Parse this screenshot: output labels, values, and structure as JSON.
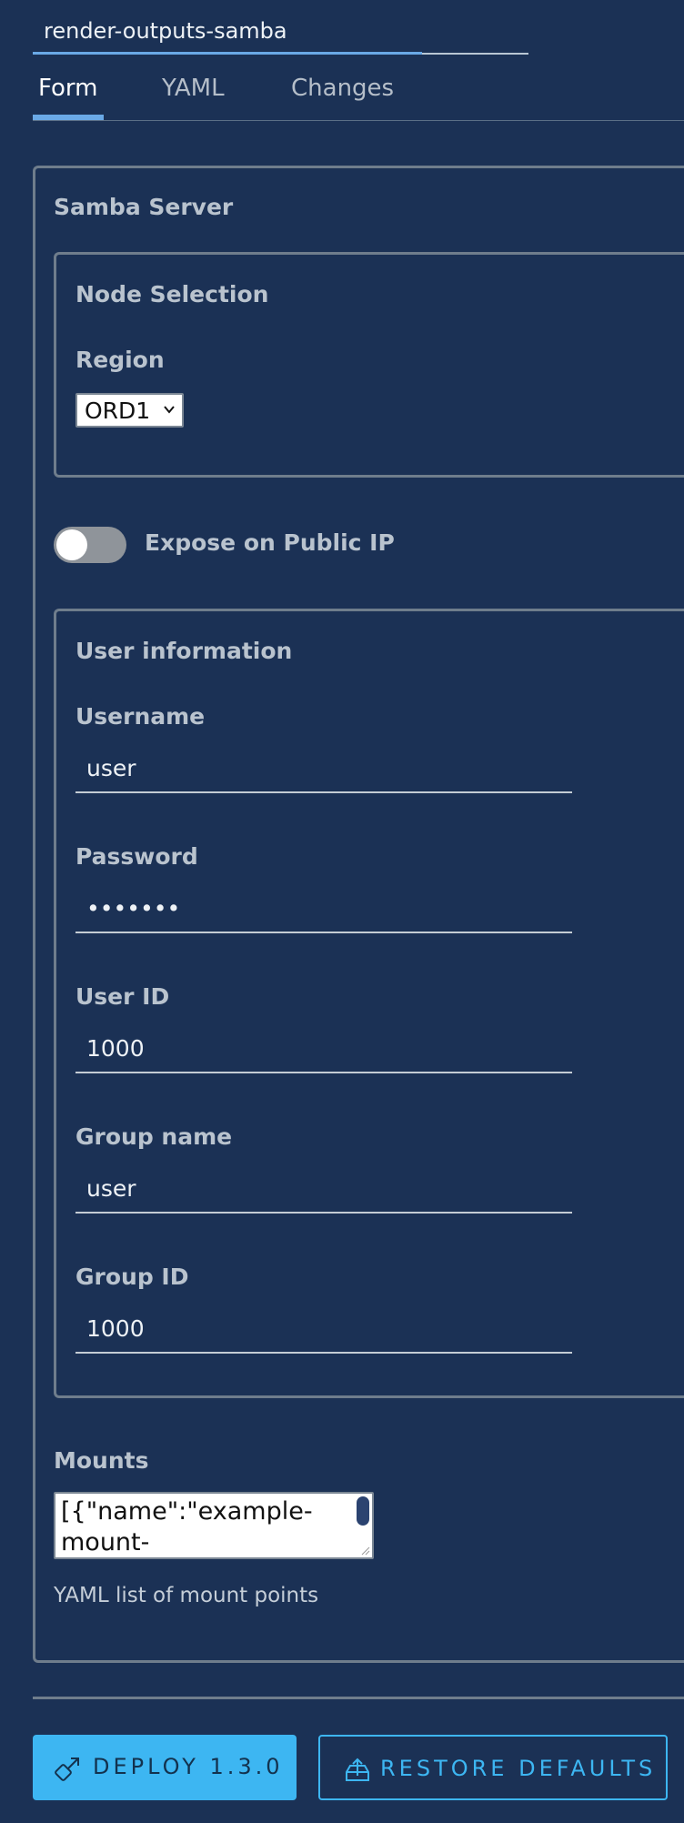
{
  "header": {
    "app_name_value": "render-outputs-samba"
  },
  "tabs": [
    {
      "label": "Form",
      "active": true
    },
    {
      "label": "YAML",
      "active": false
    },
    {
      "label": "Changes",
      "active": false
    }
  ],
  "form": {
    "section_title": "Samba Server",
    "node_selection": {
      "title": "Node Selection",
      "region_label": "Region",
      "region_value": "ORD1"
    },
    "expose_public_ip": {
      "label": "Expose on Public IP",
      "enabled": false
    },
    "user_info": {
      "title": "User information",
      "fields": [
        {
          "label": "Username",
          "value": "user"
        },
        {
          "label": "Password",
          "value": "•••••••"
        },
        {
          "label": "User ID",
          "value": "1000"
        },
        {
          "label": "Group name",
          "value": "user"
        },
        {
          "label": "Group ID",
          "value": "1000"
        }
      ]
    },
    "mounts": {
      "label": "Mounts",
      "value": "[{\"name\":\"example-\nmount-",
      "hint": "YAML list of mount points"
    }
  },
  "actions": {
    "deploy_label": "DEPLOY 1.3.0",
    "restore_label": "RESTORE DEFAULTS"
  },
  "colors": {
    "background": "#1b3155",
    "accent": "#3db6f2",
    "tab_underline": "#6aa9e6"
  }
}
